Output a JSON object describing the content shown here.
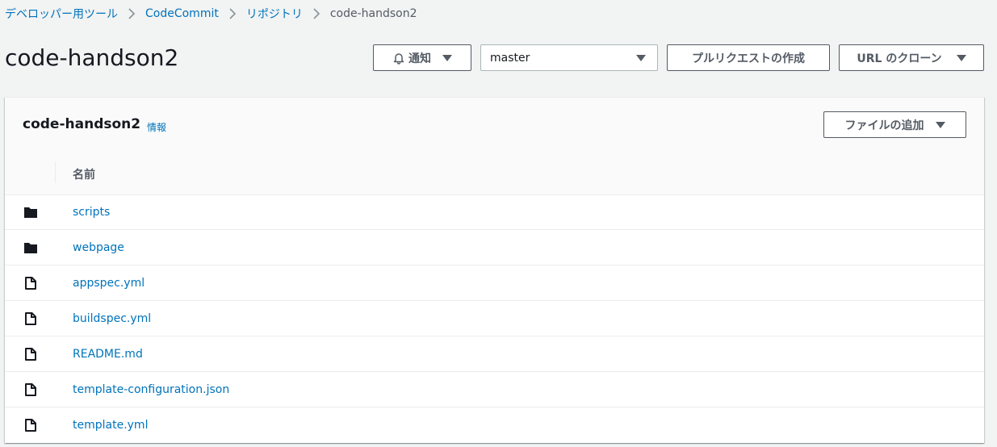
{
  "breadcrumb": {
    "items": [
      "デベロッパー用ツール",
      "CodeCommit",
      "リポジトリ"
    ],
    "current": "code-handson2"
  },
  "page": {
    "title": "code-handson2"
  },
  "toolbar": {
    "notify_label": "通知",
    "branch_value": "master",
    "pull_request_label": "プルリクエストの作成",
    "clone_url_label": "URL のクローン"
  },
  "panel": {
    "title": "code-handson2",
    "info_label": "情報",
    "add_file_label": "ファイルの追加",
    "column_name": "名前"
  },
  "files": [
    {
      "name": "scripts",
      "type": "folder"
    },
    {
      "name": "webpage",
      "type": "folder"
    },
    {
      "name": "appspec.yml",
      "type": "file"
    },
    {
      "name": "buildspec.yml",
      "type": "file"
    },
    {
      "name": "README.md",
      "type": "file"
    },
    {
      "name": "template-configuration.json",
      "type": "file"
    },
    {
      "name": "template.yml",
      "type": "file"
    }
  ],
  "colors": {
    "link": "#0073bb",
    "background": "#f2f3f3",
    "button_text": "#545b64"
  },
  "icons": [
    "chevron-right-icon",
    "bell-icon",
    "caret-down-icon",
    "folder-icon",
    "file-icon"
  ]
}
